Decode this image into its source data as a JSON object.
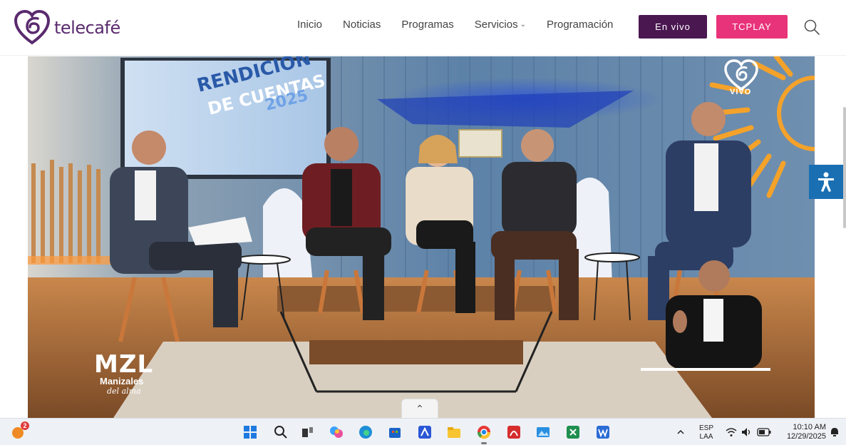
{
  "header": {
    "logo_text": "telecafé",
    "nav": [
      {
        "label": "Inicio"
      },
      {
        "label": "Noticias"
      },
      {
        "label": "Programas"
      },
      {
        "label": "Servicios",
        "has_dropdown": true
      },
      {
        "label": "Programación"
      }
    ],
    "envivo_label": "En vivo",
    "tcplay_label": "TCPLAY",
    "colors": {
      "envivo": "#4a1751",
      "tcplay": "#e8337a",
      "brand": "#5a2a6e"
    }
  },
  "video": {
    "screen_text_1": "RENDICIÓN",
    "screen_text_2": "DE CUENTAS",
    "screen_text_3": "2025",
    "live_label": "VIVO",
    "mzl_big": "MZL",
    "mzl_sub": "Manizales",
    "mzl_script": "del alma"
  },
  "taskbar": {
    "weather_badge": "2",
    "lang_line1": "ESP",
    "lang_line2": "LAA",
    "time": "10:10 AM",
    "date": "12/29/2025",
    "apps": [
      "start-icon",
      "search-icon",
      "task-view-icon",
      "copilot-icon",
      "edge-icon",
      "store-icon",
      "app-icon",
      "file-explorer-icon",
      "chrome-icon",
      "acrobat-icon",
      "photos-icon",
      "excel-icon",
      "word-icon"
    ]
  }
}
